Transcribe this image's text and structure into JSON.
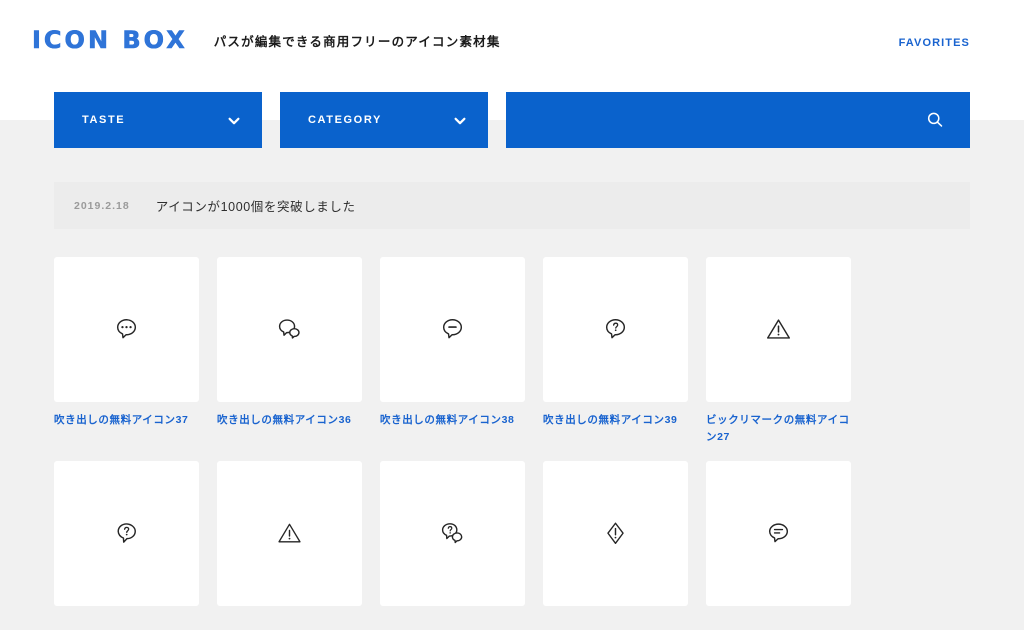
{
  "header": {
    "logo_text": "ICON BOX",
    "tagline": "パスが編集できる商用フリーのアイコン素材集",
    "favorites_label": "FAVORITES",
    "logo_color": "#2f74d8",
    "favorites_color": "#1963cf"
  },
  "filters": {
    "taste_label": "TASTE",
    "category_label": "CATEGORY",
    "search_value": "",
    "search_placeholder": "",
    "accent_color": "#0a62cc"
  },
  "news": {
    "date": "2019.2.18",
    "title": "アイコンが1000個を突破しました",
    "background": "#ececec"
  },
  "icons": [
    {
      "label": "吹き出しの無料アイコン37",
      "glyph": "bubble-dots-icon"
    },
    {
      "label": "吹き出しの無料アイコン36",
      "glyph": "bubble-double-icon"
    },
    {
      "label": "吹き出しの無料アイコン38",
      "glyph": "bubble-minus-icon"
    },
    {
      "label": "吹き出しの無料アイコン39",
      "glyph": "bubble-question-icon"
    },
    {
      "label": "ビックリマークの無料アイコン27",
      "glyph": "warning-triangle-icon"
    },
    {
      "label": "",
      "glyph": "bubble-question-round-icon"
    },
    {
      "label": "",
      "glyph": "warning-triangle-outline-icon"
    },
    {
      "label": "",
      "glyph": "bubble-double-question-icon"
    },
    {
      "label": "",
      "glyph": "diamond-exclaim-icon"
    },
    {
      "label": "",
      "glyph": "bubble-lines-icon"
    }
  ]
}
